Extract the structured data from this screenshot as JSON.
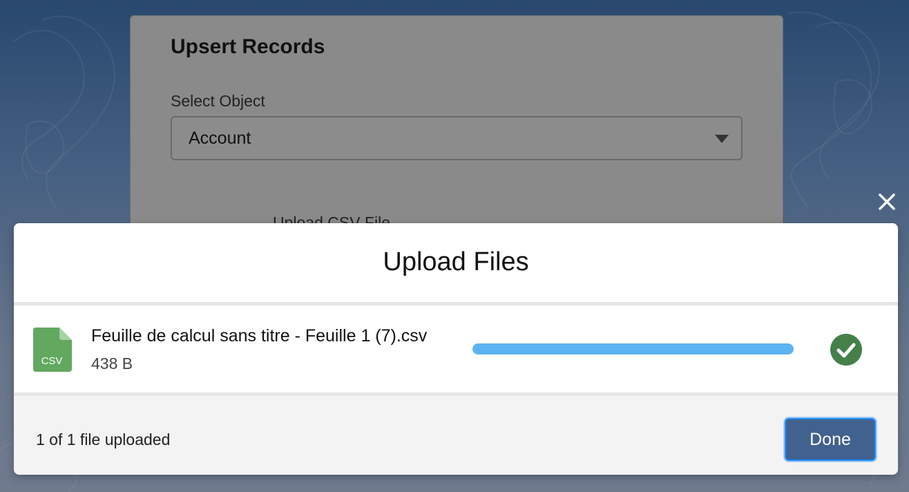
{
  "background": {
    "card_title": "Upsert Records",
    "select_label": "Select Object",
    "select_value": "Account",
    "upload_label": "Upload CSV File"
  },
  "modal": {
    "title": "Upload Files",
    "close_icon": "close-icon",
    "file": {
      "icon": "csv-file-icon",
      "icon_text": "CSV",
      "name": "Feuille de calcul sans titre - Feuille 1 (7).csv",
      "size": "438 B",
      "progress_percent": 100,
      "status_icon": "check-circle-icon"
    },
    "footer": {
      "status": "1 of 1 file uploaded",
      "done_label": "Done"
    }
  },
  "colors": {
    "progress": "#5bb3f1",
    "success": "#45804b",
    "csv_icon": "#62a85f",
    "done_button": "#41628f"
  }
}
